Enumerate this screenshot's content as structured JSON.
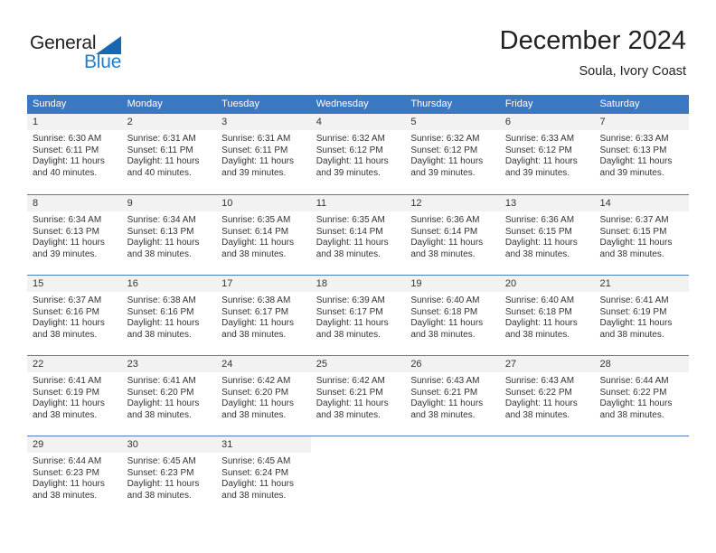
{
  "logo": {
    "word1": "General",
    "word2": "Blue",
    "triangle_color": "#1668b3",
    "blue_color": "#2080d0"
  },
  "header": {
    "month_title": "December 2024",
    "location": "Soula, Ivory Coast"
  },
  "colors": {
    "header_row_bg": "#3a78c2",
    "day_number_bg": "#f2f2f2",
    "text": "#333333"
  },
  "weekdays": [
    "Sunday",
    "Monday",
    "Tuesday",
    "Wednesday",
    "Thursday",
    "Friday",
    "Saturday"
  ],
  "weeks": [
    [
      {
        "day": "1",
        "sunrise": "Sunrise: 6:30 AM",
        "sunset": "Sunset: 6:11 PM",
        "daylight": "Daylight: 11 hours and 40 minutes."
      },
      {
        "day": "2",
        "sunrise": "Sunrise: 6:31 AM",
        "sunset": "Sunset: 6:11 PM",
        "daylight": "Daylight: 11 hours and 40 minutes."
      },
      {
        "day": "3",
        "sunrise": "Sunrise: 6:31 AM",
        "sunset": "Sunset: 6:11 PM",
        "daylight": "Daylight: 11 hours and 39 minutes."
      },
      {
        "day": "4",
        "sunrise": "Sunrise: 6:32 AM",
        "sunset": "Sunset: 6:12 PM",
        "daylight": "Daylight: 11 hours and 39 minutes."
      },
      {
        "day": "5",
        "sunrise": "Sunrise: 6:32 AM",
        "sunset": "Sunset: 6:12 PM",
        "daylight": "Daylight: 11 hours and 39 minutes."
      },
      {
        "day": "6",
        "sunrise": "Sunrise: 6:33 AM",
        "sunset": "Sunset: 6:12 PM",
        "daylight": "Daylight: 11 hours and 39 minutes."
      },
      {
        "day": "7",
        "sunrise": "Sunrise: 6:33 AM",
        "sunset": "Sunset: 6:13 PM",
        "daylight": "Daylight: 11 hours and 39 minutes."
      }
    ],
    [
      {
        "day": "8",
        "sunrise": "Sunrise: 6:34 AM",
        "sunset": "Sunset: 6:13 PM",
        "daylight": "Daylight: 11 hours and 39 minutes."
      },
      {
        "day": "9",
        "sunrise": "Sunrise: 6:34 AM",
        "sunset": "Sunset: 6:13 PM",
        "daylight": "Daylight: 11 hours and 38 minutes."
      },
      {
        "day": "10",
        "sunrise": "Sunrise: 6:35 AM",
        "sunset": "Sunset: 6:14 PM",
        "daylight": "Daylight: 11 hours and 38 minutes."
      },
      {
        "day": "11",
        "sunrise": "Sunrise: 6:35 AM",
        "sunset": "Sunset: 6:14 PM",
        "daylight": "Daylight: 11 hours and 38 minutes."
      },
      {
        "day": "12",
        "sunrise": "Sunrise: 6:36 AM",
        "sunset": "Sunset: 6:14 PM",
        "daylight": "Daylight: 11 hours and 38 minutes."
      },
      {
        "day": "13",
        "sunrise": "Sunrise: 6:36 AM",
        "sunset": "Sunset: 6:15 PM",
        "daylight": "Daylight: 11 hours and 38 minutes."
      },
      {
        "day": "14",
        "sunrise": "Sunrise: 6:37 AM",
        "sunset": "Sunset: 6:15 PM",
        "daylight": "Daylight: 11 hours and 38 minutes."
      }
    ],
    [
      {
        "day": "15",
        "sunrise": "Sunrise: 6:37 AM",
        "sunset": "Sunset: 6:16 PM",
        "daylight": "Daylight: 11 hours and 38 minutes."
      },
      {
        "day": "16",
        "sunrise": "Sunrise: 6:38 AM",
        "sunset": "Sunset: 6:16 PM",
        "daylight": "Daylight: 11 hours and 38 minutes."
      },
      {
        "day": "17",
        "sunrise": "Sunrise: 6:38 AM",
        "sunset": "Sunset: 6:17 PM",
        "daylight": "Daylight: 11 hours and 38 minutes."
      },
      {
        "day": "18",
        "sunrise": "Sunrise: 6:39 AM",
        "sunset": "Sunset: 6:17 PM",
        "daylight": "Daylight: 11 hours and 38 minutes."
      },
      {
        "day": "19",
        "sunrise": "Sunrise: 6:40 AM",
        "sunset": "Sunset: 6:18 PM",
        "daylight": "Daylight: 11 hours and 38 minutes."
      },
      {
        "day": "20",
        "sunrise": "Sunrise: 6:40 AM",
        "sunset": "Sunset: 6:18 PM",
        "daylight": "Daylight: 11 hours and 38 minutes."
      },
      {
        "day": "21",
        "sunrise": "Sunrise: 6:41 AM",
        "sunset": "Sunset: 6:19 PM",
        "daylight": "Daylight: 11 hours and 38 minutes."
      }
    ],
    [
      {
        "day": "22",
        "sunrise": "Sunrise: 6:41 AM",
        "sunset": "Sunset: 6:19 PM",
        "daylight": "Daylight: 11 hours and 38 minutes."
      },
      {
        "day": "23",
        "sunrise": "Sunrise: 6:41 AM",
        "sunset": "Sunset: 6:20 PM",
        "daylight": "Daylight: 11 hours and 38 minutes."
      },
      {
        "day": "24",
        "sunrise": "Sunrise: 6:42 AM",
        "sunset": "Sunset: 6:20 PM",
        "daylight": "Daylight: 11 hours and 38 minutes."
      },
      {
        "day": "25",
        "sunrise": "Sunrise: 6:42 AM",
        "sunset": "Sunset: 6:21 PM",
        "daylight": "Daylight: 11 hours and 38 minutes."
      },
      {
        "day": "26",
        "sunrise": "Sunrise: 6:43 AM",
        "sunset": "Sunset: 6:21 PM",
        "daylight": "Daylight: 11 hours and 38 minutes."
      },
      {
        "day": "27",
        "sunrise": "Sunrise: 6:43 AM",
        "sunset": "Sunset: 6:22 PM",
        "daylight": "Daylight: 11 hours and 38 minutes."
      },
      {
        "day": "28",
        "sunrise": "Sunrise: 6:44 AM",
        "sunset": "Sunset: 6:22 PM",
        "daylight": "Daylight: 11 hours and 38 minutes."
      }
    ],
    [
      {
        "day": "29",
        "sunrise": "Sunrise: 6:44 AM",
        "sunset": "Sunset: 6:23 PM",
        "daylight": "Daylight: 11 hours and 38 minutes."
      },
      {
        "day": "30",
        "sunrise": "Sunrise: 6:45 AM",
        "sunset": "Sunset: 6:23 PM",
        "daylight": "Daylight: 11 hours and 38 minutes."
      },
      {
        "day": "31",
        "sunrise": "Sunrise: 6:45 AM",
        "sunset": "Sunset: 6:24 PM",
        "daylight": "Daylight: 11 hours and 38 minutes."
      },
      {
        "day": "",
        "sunrise": "",
        "sunset": "",
        "daylight": ""
      },
      {
        "day": "",
        "sunrise": "",
        "sunset": "",
        "daylight": ""
      },
      {
        "day": "",
        "sunrise": "",
        "sunset": "",
        "daylight": ""
      },
      {
        "day": "",
        "sunrise": "",
        "sunset": "",
        "daylight": ""
      }
    ]
  ]
}
